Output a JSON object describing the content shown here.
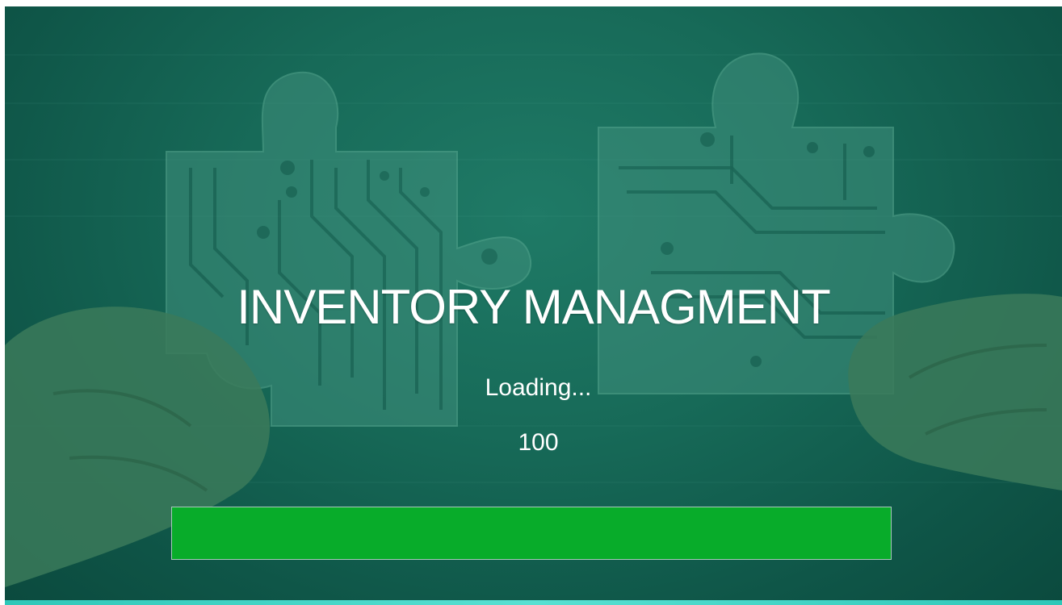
{
  "splash": {
    "title": "INVENTORY MANAGMENT",
    "loading_label": "Loading...",
    "progress_value": "100"
  },
  "progress": {
    "percent": 100
  },
  "colors": {
    "background": "#176a58",
    "progress_fill": "#08ac2a",
    "accent_strip": "#2ec7b8",
    "text": "#ffffff"
  }
}
